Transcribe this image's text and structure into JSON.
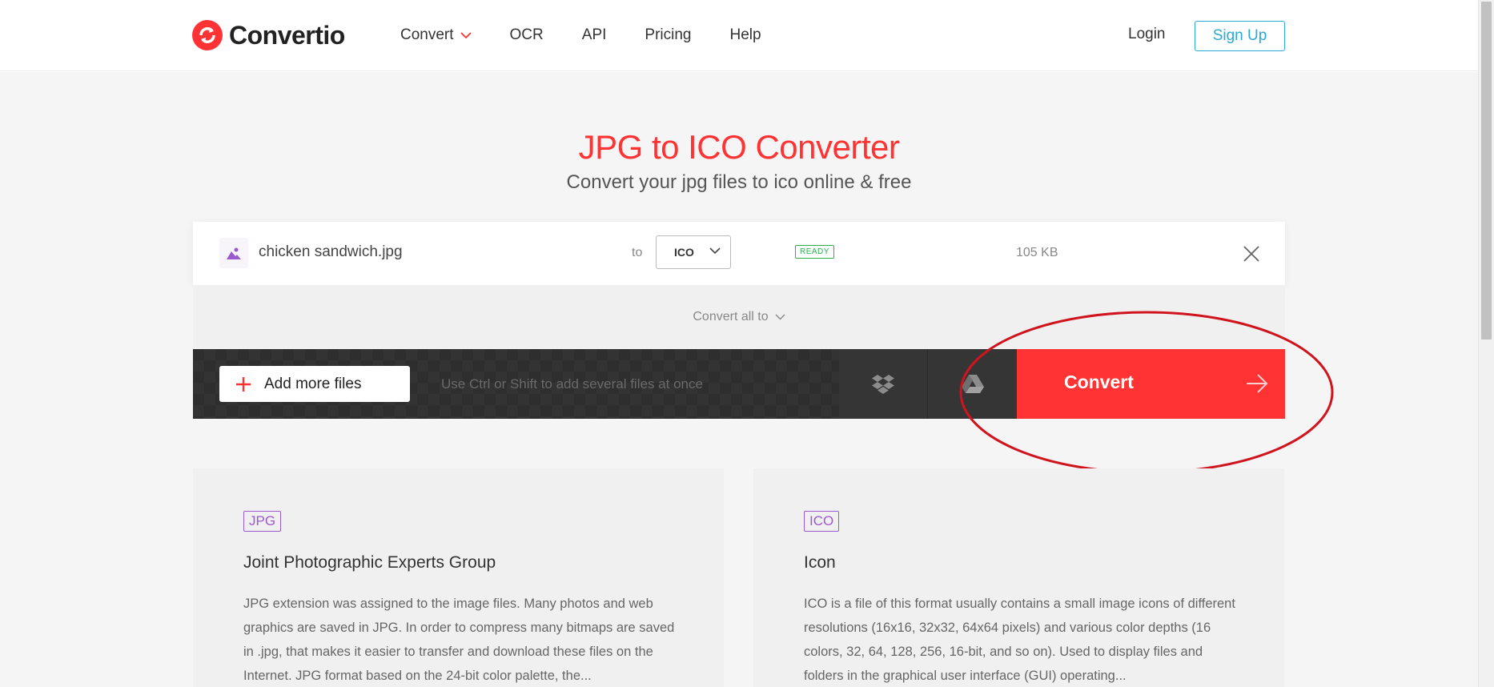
{
  "header": {
    "brand": "Convertio",
    "nav": [
      "Convert",
      "OCR",
      "API",
      "Pricing",
      "Help"
    ],
    "login": "Login",
    "signup": "Sign Up"
  },
  "hero": {
    "title": "JPG to ICO Converter",
    "subtitle": "Convert your jpg files to ico online & free"
  },
  "file": {
    "name": "chicken sandwich.jpg",
    "to_label": "to",
    "format": "ICO",
    "status": "READY",
    "size": "105 KB"
  },
  "convert_all": "Convert all to",
  "actions": {
    "add_files": "Add more files",
    "hint": "Use Ctrl or Shift to add several files at once",
    "convert": "Convert"
  },
  "cards": [
    {
      "tag": "JPG",
      "title": "Joint Photographic Experts Group",
      "body": "JPG extension was assigned to the image files. Many photos and web graphics are saved in JPG. In order to compress many bitmaps are saved in .jpg, that makes it easier to transfer and download these files on the Internet. JPG format based on the 24-bit color palette, the..."
    },
    {
      "tag": "ICO",
      "title": "Icon",
      "body": "ICO is a file of this format usually contains a small image icons of different resolutions (16x16, 32x32, 64x64 pixels) and various color depths (16 colors, 32, 64, 128, 256, 16-bit, and so on). Used to display files and folders in the graphical user interface (GUI) operating..."
    }
  ],
  "colors": {
    "brand": "#ff3333",
    "signup": "#29a9d8",
    "ready": "#2bb24c",
    "tag": "#9b59d0",
    "annotation": "#d0141e"
  },
  "icons": [
    "convertio-logo-icon",
    "chevron-down-icon",
    "image-file-icon",
    "close-icon",
    "plus-icon",
    "dropbox-icon",
    "google-drive-icon",
    "arrow-right-icon"
  ]
}
